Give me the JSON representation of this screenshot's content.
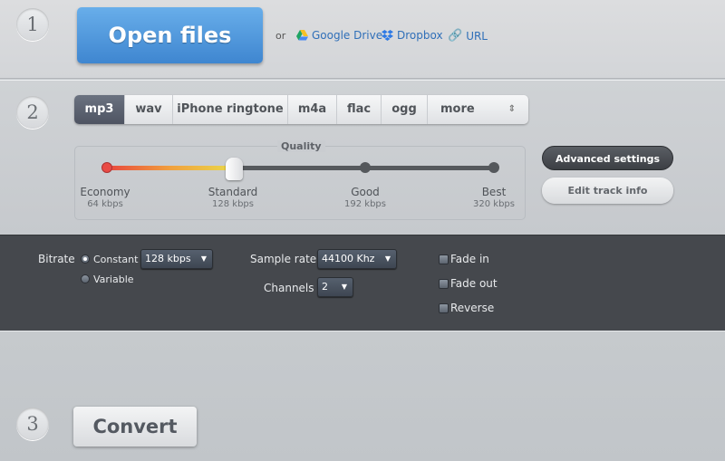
{
  "steps": [
    "1",
    "2",
    "3"
  ],
  "open": {
    "label": "Open files",
    "or": "or",
    "google_drive": "Google Drive",
    "dropbox": "Dropbox",
    "url": "URL"
  },
  "formats": {
    "tabs": [
      "mp3",
      "wav",
      "iPhone ringtone",
      "m4a",
      "flac",
      "ogg",
      "more"
    ],
    "selected": "mp3"
  },
  "quality": {
    "title": "Quality",
    "selected": "Standard",
    "levels": [
      {
        "name": "Economy",
        "rate": "64 kbps"
      },
      {
        "name": "Standard",
        "rate": "128 kbps"
      },
      {
        "name": "Good",
        "rate": "192 kbps"
      },
      {
        "name": "Best",
        "rate": "320 kbps"
      }
    ]
  },
  "buttons": {
    "advanced": "Advanced settings",
    "edit_track": "Edit track info",
    "convert": "Convert"
  },
  "advanced": {
    "bitrate_label": "Bitrate",
    "constant": "Constant",
    "variable": "Variable",
    "bitrate_mode": "Constant",
    "bitrate_value": "128 kbps",
    "sample_rate_label": "Sample rate",
    "sample_rate_value": "44100 Khz",
    "channels_label": "Channels",
    "channels_value": "2",
    "fade_in": "Fade in",
    "fade_out": "Fade out",
    "reverse": "Reverse",
    "fade_in_checked": false,
    "fade_out_checked": false,
    "reverse_checked": false
  },
  "colors": {
    "accent": "#4d96dc",
    "dark_panel": "#45484d",
    "link": "#2f6fb8"
  }
}
